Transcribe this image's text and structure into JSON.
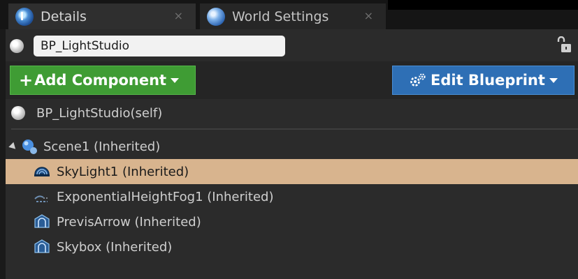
{
  "tabs": [
    {
      "label": "Details",
      "icon": "details-icon",
      "active": true
    },
    {
      "label": "World Settings",
      "icon": "world-settings-icon",
      "active": false
    }
  ],
  "tab_close_glyph": "×",
  "actor": {
    "name_value": "BP_LightStudio",
    "self_label": "BP_LightStudio(self)"
  },
  "toolbar": {
    "add_component_label": "Add Component",
    "add_plus_glyph": "+",
    "edit_blueprint_label": "Edit Blueprint"
  },
  "components": {
    "root": {
      "label": "Scene1 (Inherited)",
      "icon": "scene-icon"
    },
    "children": [
      {
        "label": "SkyLight1 (Inherited)",
        "icon": "skylight-icon",
        "selected": true
      },
      {
        "label": "ExponentialHeightFog1 (Inherited)",
        "icon": "height-fog-icon",
        "selected": false
      },
      {
        "label": "PrevisArrow (Inherited)",
        "icon": "static-mesh-icon",
        "selected": false
      },
      {
        "label": "Skybox (Inherited)",
        "icon": "static-mesh-icon",
        "selected": false
      }
    ]
  },
  "colors": {
    "add_button": "#3f9c34",
    "edit_button": "#2e6fb5",
    "selection": "#d8b48e",
    "panel": "#2b2b2b"
  }
}
